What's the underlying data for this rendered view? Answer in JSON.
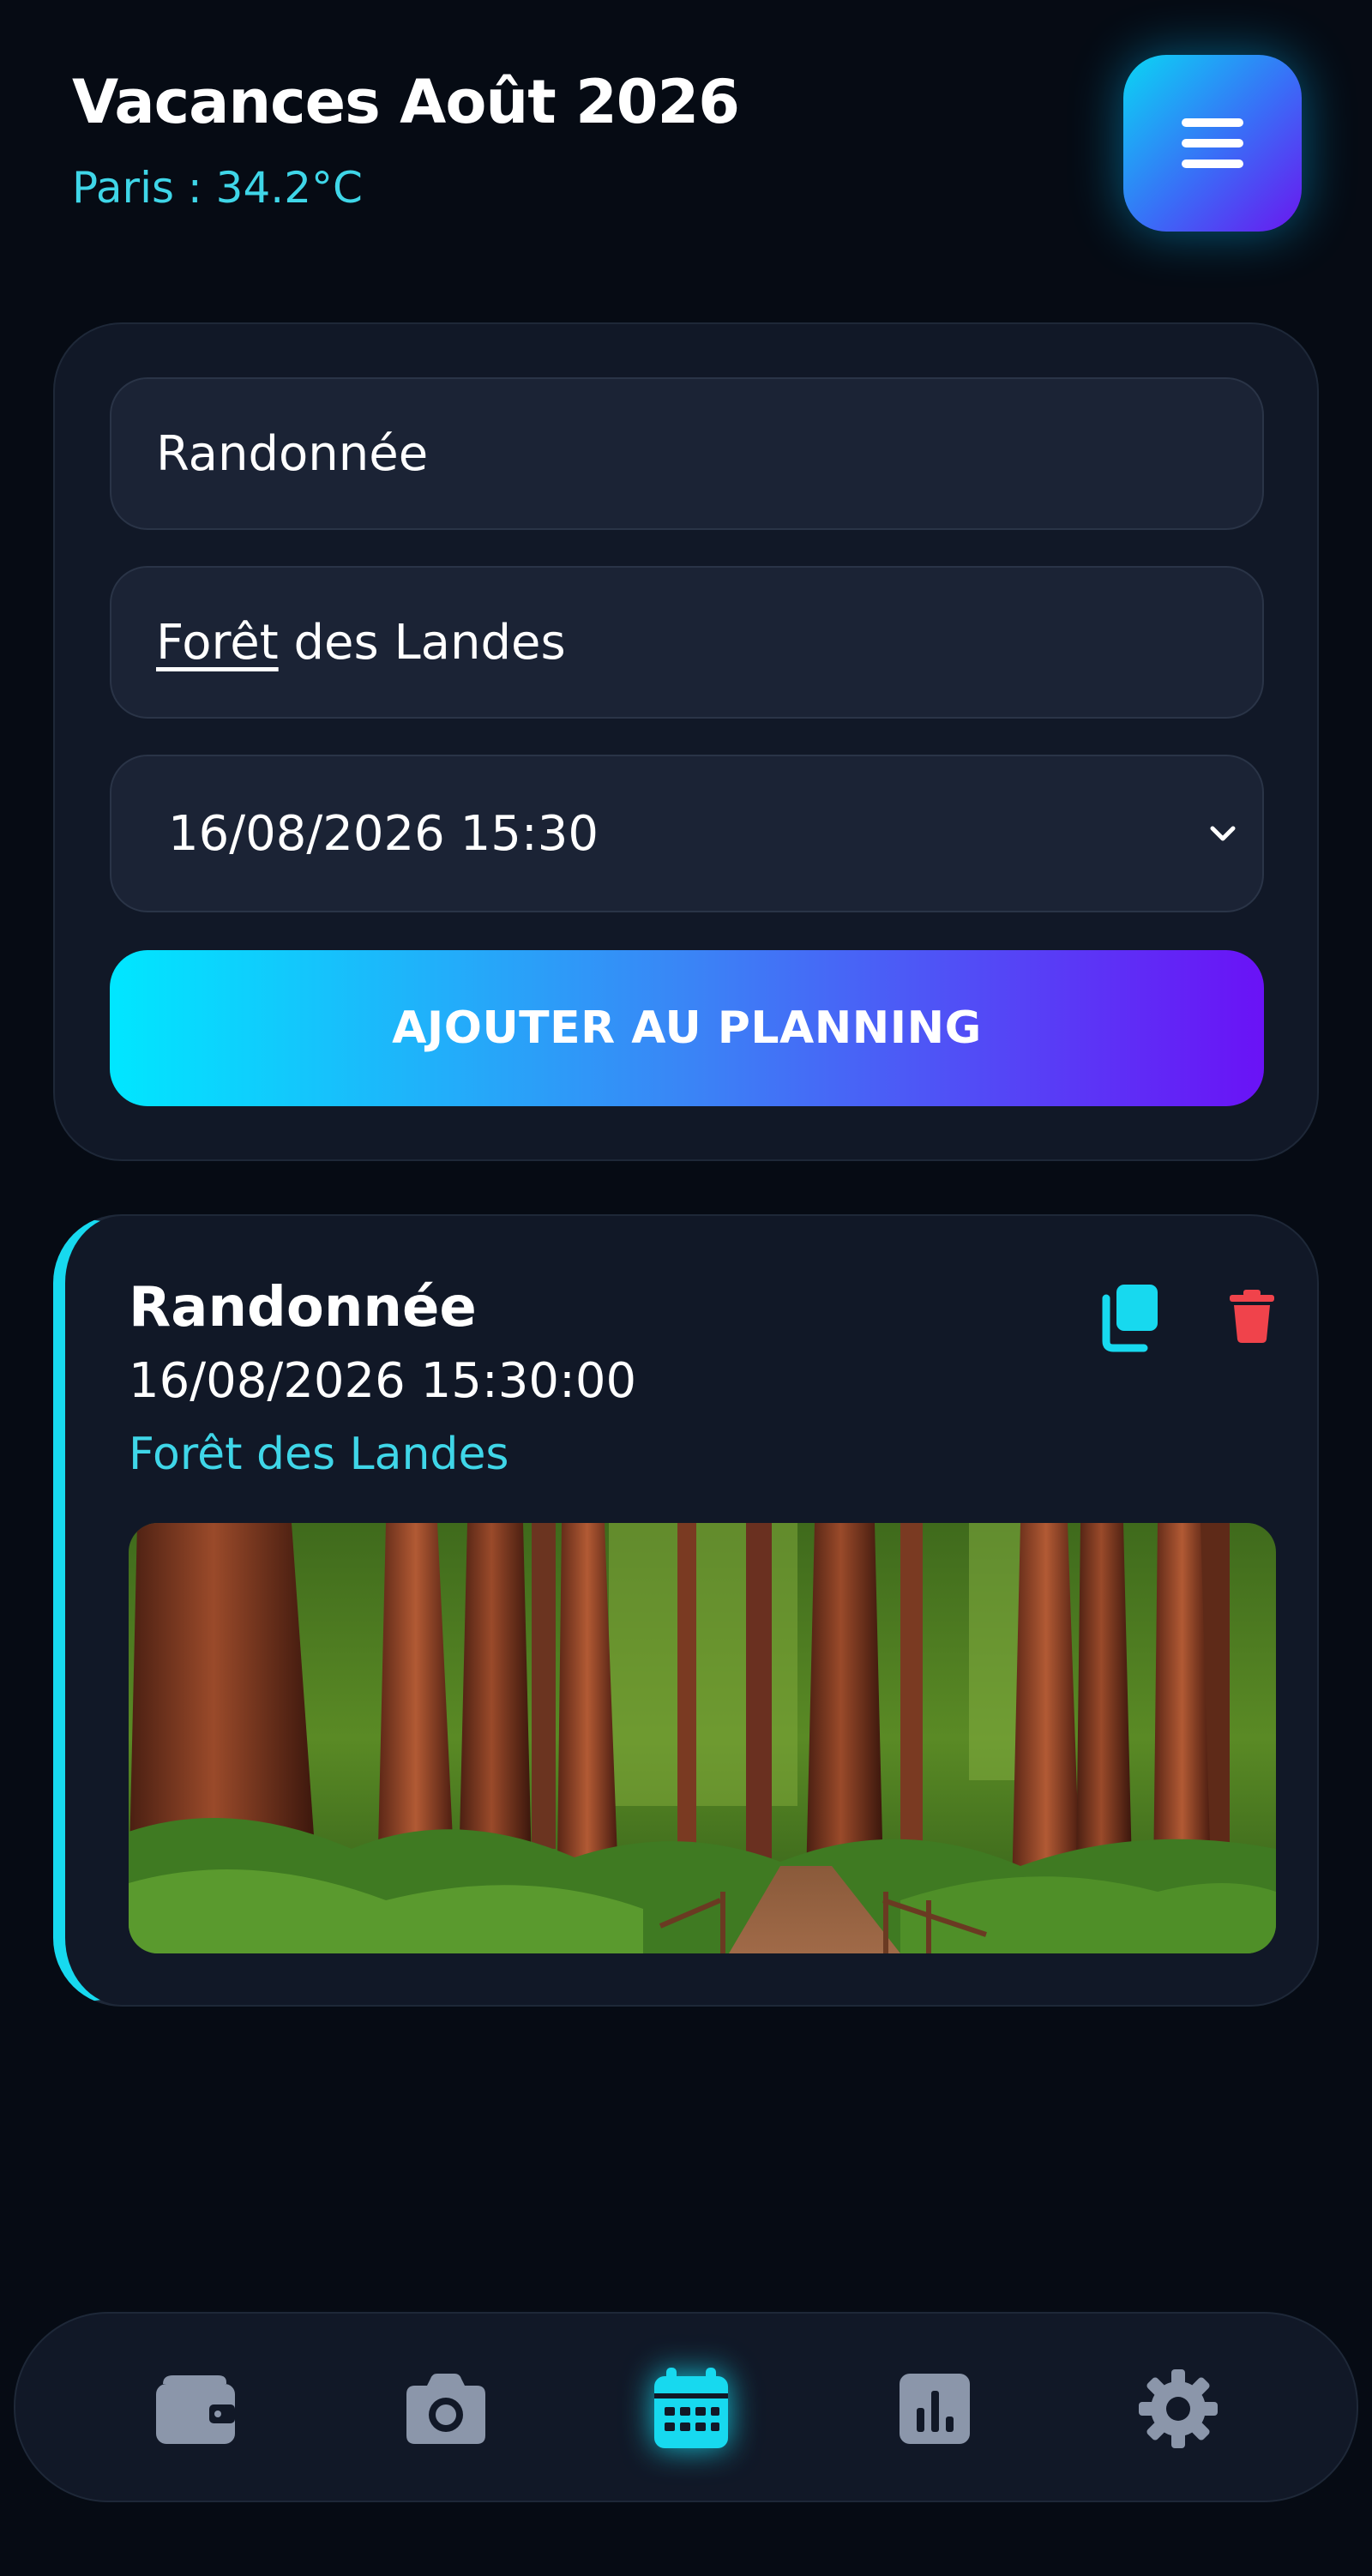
{
  "header": {
    "title": "Vacances Août 2026",
    "weather": "Paris : 34.2°C",
    "menu_icon": "hamburger-menu-icon"
  },
  "form": {
    "activity_value": "Randonnée",
    "location_value_first": "Forêt",
    "location_value_rest": " des Landes",
    "datetime_value": "16/08/2026 15:30",
    "submit_label": "AJOUTER AU PLANNING"
  },
  "events": [
    {
      "title": "Randonnée",
      "datetime": "16/08/2026 15:30:00",
      "place": "Forêt des Landes",
      "actions": [
        "copy-icon",
        "trash-icon"
      ],
      "image": "redwood-forest-trail-photo"
    }
  ],
  "bottom_nav": {
    "items": [
      "wallet-icon",
      "camera-icon",
      "calendar-icon",
      "bar-chart-icon",
      "gear-icon"
    ],
    "active": "calendar-icon"
  },
  "colors": {
    "background": "#060b14",
    "card": "#111827",
    "accent_cyan": "#17d9ef",
    "accent_purple": "#6a12f6",
    "danger": "#f0434b",
    "icon_muted": "#8b96aa"
  }
}
